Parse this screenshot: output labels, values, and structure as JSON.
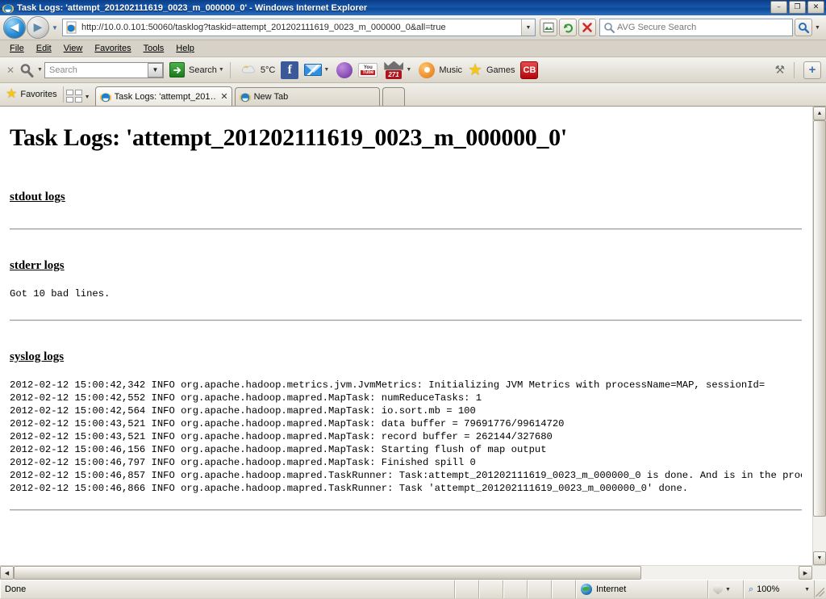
{
  "window": {
    "title": "Task Logs: 'attempt_201202111619_0023_m_000000_0' - Windows Internet Explorer",
    "minimize_label": "–",
    "restore_label": "❐",
    "close_label": "✕"
  },
  "nav": {
    "back_label": "◀",
    "forward_label": "▶",
    "recent_pages_caret": "▼",
    "address_value": "http://10.0.0.101:50060/tasklog?taskid=attempt_201202111619_0023_m_000000_0&all=true",
    "address_dropdown_caret": "▼",
    "search_placeholder": "AVG Secure Search",
    "search_go_label": "⌕",
    "search_go_caret": "▼"
  },
  "menu": {
    "items": [
      {
        "label": "File",
        "accel": "F"
      },
      {
        "label": "Edit",
        "accel": "E"
      },
      {
        "label": "View",
        "accel": "V"
      },
      {
        "label": "Favorites",
        "accel": "a"
      },
      {
        "label": "Tools",
        "accel": "T"
      },
      {
        "label": "Help",
        "accel": "H"
      }
    ]
  },
  "avg_toolbar": {
    "close_label": "✕",
    "magnifier_caret": "▼",
    "search_placeholder": "Search",
    "search_dropdown_caret": "▼",
    "search_button_label": "Search",
    "search_button_arrow": "➜",
    "search_button_caret": "▼",
    "weather_temp": "5°C",
    "facebook_label": "f",
    "youtube_top": "You",
    "youtube_bottom": "Tube",
    "notifications_count": "271",
    "notifications_caret": "▼",
    "music_label": "Music",
    "games_label": "Games",
    "games_glyph": "★",
    "cb_label": "CB",
    "settings_glyph": "⚒",
    "add_glyph": "+"
  },
  "tabs": {
    "favorites_label": "Favorites",
    "favorites_star": "★",
    "quick_tabs_caret": "▼",
    "items": [
      {
        "label": "Task Logs: 'attempt_201…",
        "active": true,
        "close_label": "✕"
      },
      {
        "label": "New Tab",
        "active": false,
        "close_label": ""
      }
    ]
  },
  "page": {
    "title": "Task Logs: 'attempt_201202111619_0023_m_000000_0'",
    "sections": [
      {
        "heading": "stdout logs",
        "body": ""
      },
      {
        "heading": "stderr logs",
        "body": "Got 10 bad lines."
      },
      {
        "heading": "syslog logs",
        "body": "2012-02-12 15:00:42,342 INFO org.apache.hadoop.metrics.jvm.JvmMetrics: Initializing JVM Metrics with processName=MAP, sessionId=\n2012-02-12 15:00:42,552 INFO org.apache.hadoop.mapred.MapTask: numReduceTasks: 1\n2012-02-12 15:00:42,564 INFO org.apache.hadoop.mapred.MapTask: io.sort.mb = 100\n2012-02-12 15:00:43,521 INFO org.apache.hadoop.mapred.MapTask: data buffer = 79691776/99614720\n2012-02-12 15:00:43,521 INFO org.apache.hadoop.mapred.MapTask: record buffer = 262144/327680\n2012-02-12 15:00:46,156 INFO org.apache.hadoop.mapred.MapTask: Starting flush of map output\n2012-02-12 15:00:46,797 INFO org.apache.hadoop.mapred.MapTask: Finished spill 0\n2012-02-12 15:00:46,857 INFO org.apache.hadoop.mapred.TaskRunner: Task:attempt_201202111619_0023_m_000000_0 is done. And is in the process of commiting\n2012-02-12 15:00:46,866 INFO org.apache.hadoop.mapred.TaskRunner: Task 'attempt_201202111619_0023_m_000000_0' done."
      }
    ]
  },
  "scrollbars": {
    "up_arrow": "▲",
    "down_arrow": "▼",
    "left_arrow": "◀",
    "right_arrow": "▶"
  },
  "statusbar": {
    "message": "Done",
    "zone_label": "Internet",
    "protected_caret": "▼",
    "zoom_level": "100%",
    "zoom_caret": "▼",
    "zoom_glyph": "⌕"
  }
}
